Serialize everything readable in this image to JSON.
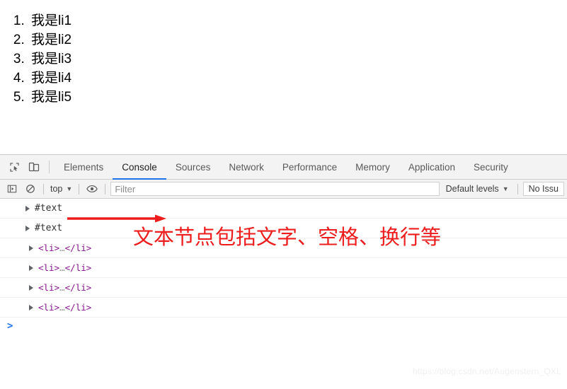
{
  "page": {
    "list_items": [
      "我是li1",
      "我是li2",
      "我是li3",
      "我是li4",
      "我是li5"
    ]
  },
  "devtools": {
    "tool_buttons": [
      {
        "name": "inspect-element-icon",
        "label": "Inspect element"
      },
      {
        "name": "device-toolbar-icon",
        "label": "Toggle device toolbar"
      }
    ],
    "tabs": [
      {
        "label": "Elements",
        "active": false
      },
      {
        "label": "Console",
        "active": true
      },
      {
        "label": "Sources",
        "active": false
      },
      {
        "label": "Network",
        "active": false
      },
      {
        "label": "Performance",
        "active": false
      },
      {
        "label": "Memory",
        "active": false
      },
      {
        "label": "Application",
        "active": false
      },
      {
        "label": "Security",
        "active": false
      }
    ],
    "filterbar": {
      "sidebar_toggle_icon": "console-sidebar-icon",
      "clear_console_icon": "clear-console-icon",
      "context_label": "top",
      "context_caret": "▼",
      "eye_icon": "live-expression-eye-icon",
      "filter_placeholder": "Filter",
      "levels_label": "Default levels",
      "levels_caret": "▼",
      "issues_label": "No Issu"
    },
    "console_rows": [
      {
        "type": "text-node",
        "label": "#text",
        "indent": false
      },
      {
        "type": "text-node",
        "label": "#text",
        "indent": false
      },
      {
        "type": "element",
        "open_tag": "<li>",
        "ellipsis": "…",
        "close_tag": "</li>",
        "indent": true
      },
      {
        "type": "element",
        "open_tag": "<li>",
        "ellipsis": "…",
        "close_tag": "</li>",
        "indent": true
      },
      {
        "type": "element",
        "open_tag": "<li>",
        "ellipsis": "…",
        "close_tag": "</li>",
        "indent": true
      },
      {
        "type": "element",
        "open_tag": "<li>",
        "ellipsis": "…",
        "close_tag": "</li>",
        "indent": true
      }
    ],
    "prompt_chevron": ">"
  },
  "annotations": {
    "arrow_color": "#ee1c1c",
    "note_text": "文本节点包括文字、空格、换行等",
    "note_color": "#ee1c1c"
  },
  "watermark": {
    "text": "https://blog.csdn.net/Augenstern_QXL",
    "color": "#f0f0f0"
  }
}
